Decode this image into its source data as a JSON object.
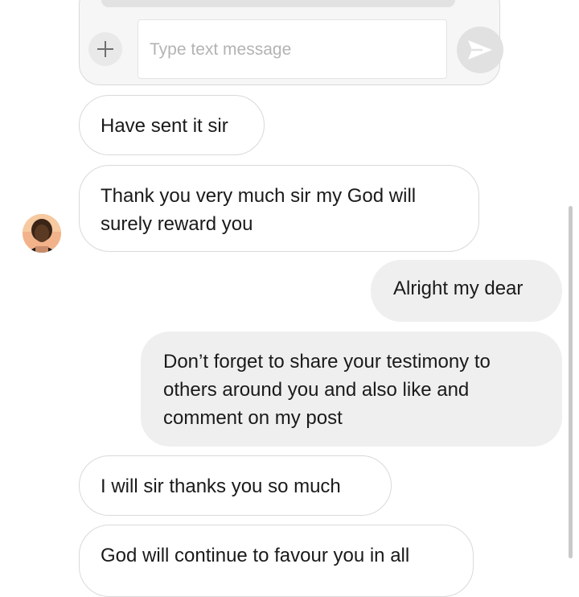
{
  "composer": {
    "placeholder": "Type text message",
    "add_icon": "plus-icon",
    "send_icon": "send-arrow-icon"
  },
  "messages": [
    {
      "direction": "incoming",
      "text": "Have sent it sir"
    },
    {
      "direction": "incoming",
      "text": "Thank you very much sir my God will surely reward you"
    },
    {
      "direction": "outgoing",
      "text": "Alright my dear"
    },
    {
      "direction": "outgoing",
      "text": "Don’t forget to share your testimony to others around you and also like and comment on my post"
    },
    {
      "direction": "incoming",
      "text": "I will sir thanks you so much"
    },
    {
      "direction": "incoming",
      "text": "God will continue to favour you in all"
    }
  ],
  "colors": {
    "incoming_bubble": "#ffffff",
    "outgoing_bubble": "#efefef",
    "border": "#d9d9d9",
    "placeholder_text": "#b3b3b3"
  }
}
